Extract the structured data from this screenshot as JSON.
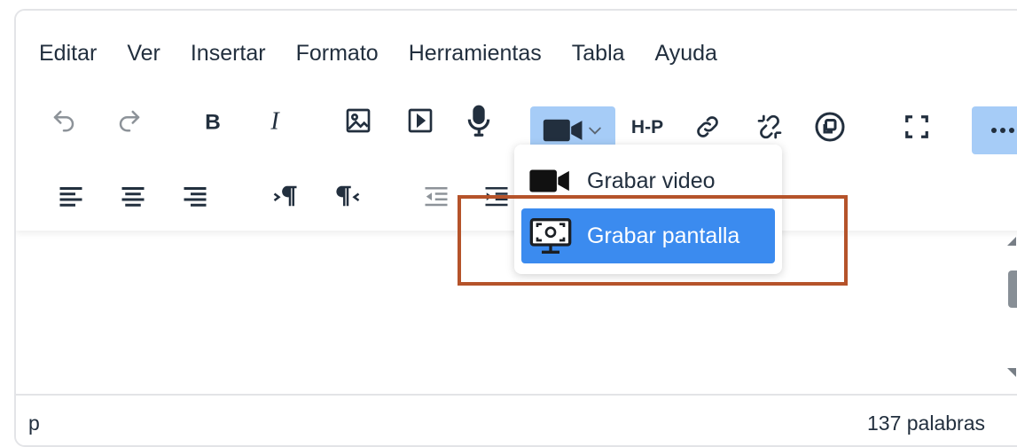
{
  "menubar": {
    "items": [
      "Editar",
      "Ver",
      "Insertar",
      "Formato",
      "Herramientas",
      "Tabla",
      "Ayuda"
    ]
  },
  "toolbar_row1": [
    {
      "icon": "undo-icon",
      "state": "disabled"
    },
    {
      "icon": "redo-icon",
      "state": "disabled"
    },
    {
      "icon": "bold-icon"
    },
    {
      "icon": "italic-icon"
    },
    {
      "icon": "image-icon"
    },
    {
      "icon": "media-icon"
    },
    {
      "icon": "microphone-icon"
    },
    {
      "icon": "video-camera-icon",
      "state": "active",
      "has_dropdown": true
    },
    {
      "icon": "h5p-icon",
      "text": "H-P"
    },
    {
      "icon": "link-icon"
    },
    {
      "icon": "unlink-icon"
    },
    {
      "icon": "copy-circle-icon"
    },
    {
      "icon": "fullscreen-icon"
    },
    {
      "icon": "more-icon",
      "state": "active"
    }
  ],
  "toolbar_row2": [
    {
      "icon": "align-left-icon"
    },
    {
      "icon": "align-center-icon"
    },
    {
      "icon": "align-right-icon"
    },
    {
      "icon": "ltr-icon"
    },
    {
      "icon": "rtl-icon"
    },
    {
      "icon": "outdent-icon",
      "state": "disabled"
    },
    {
      "icon": "indent-icon"
    }
  ],
  "dropdown": {
    "items": [
      {
        "label": "Grabar video",
        "icon": "video-camera-icon",
        "selected": false
      },
      {
        "label": "Grabar pantalla",
        "icon": "screen-record-icon",
        "selected": true
      }
    ]
  },
  "statusbar": {
    "path": "p",
    "wordcount": "137 palabras"
  },
  "colors": {
    "accent": "#3b8bef",
    "active_button": "#a6ccf7",
    "highlight_border": "#b5532a",
    "text": "#222f3e",
    "disabled": "#8d9399"
  }
}
